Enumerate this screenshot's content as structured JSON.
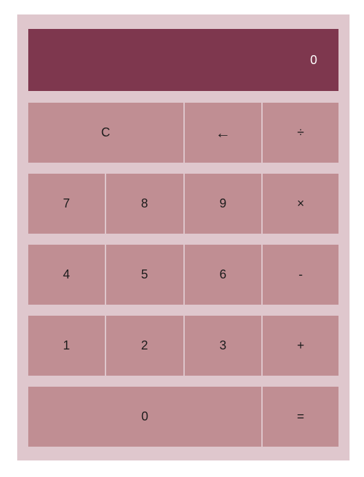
{
  "display": {
    "value": "0"
  },
  "keys": {
    "clear": "C",
    "backspace": "←",
    "divide": "÷",
    "seven": "7",
    "eight": "8",
    "nine": "9",
    "multiply": "×",
    "four": "4",
    "five": "5",
    "six": "6",
    "subtract": "-",
    "one": "1",
    "two": "2",
    "three": "3",
    "add": "+",
    "zero": "0",
    "equals": "="
  },
  "colors": {
    "background": "#dfc7cd",
    "display": "#7e374e",
    "key": "#c08e93",
    "display_text": "#ffffff"
  }
}
